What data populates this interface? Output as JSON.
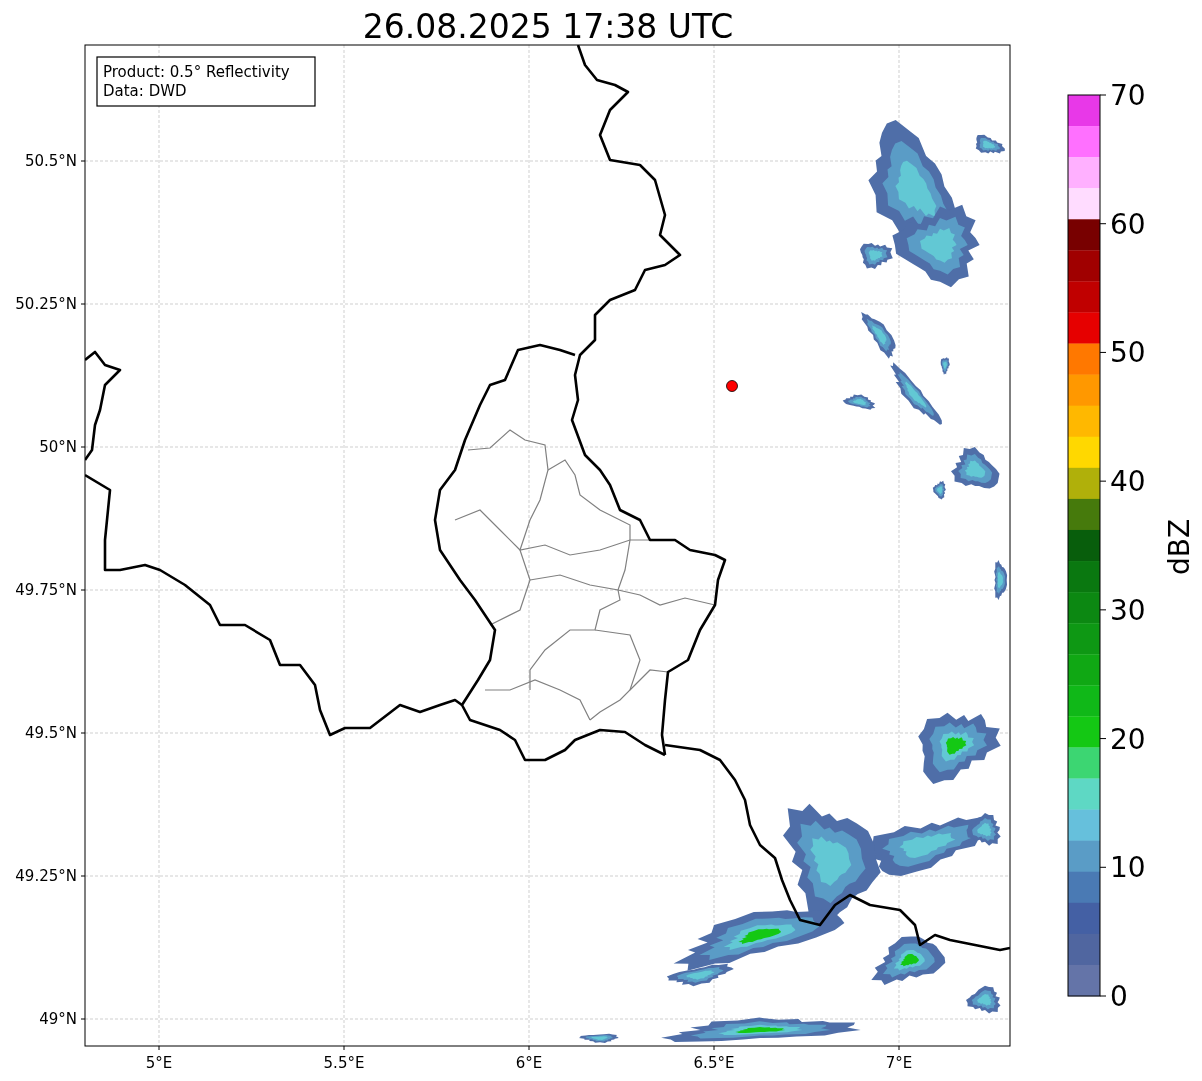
{
  "title": "26.08.2025 17:38 UTC",
  "map": {
    "legend": [
      "Product: 0.5° Reflectivity",
      "Data: DWD"
    ],
    "lat_labels": [
      "50.5°N",
      "50.25°N",
      "50°N",
      "49.75°N",
      "49.5°N",
      "49.25°N",
      "49°N"
    ],
    "lon_labels": [
      "5°E",
      "5.5°E",
      "6°E",
      "6.5°E",
      "7°E"
    ]
  },
  "colorbar": {
    "label": "dBZ",
    "ticks": [
      "70",
      "60",
      "50",
      "40",
      "30",
      "20",
      "10",
      "0"
    ],
    "colors": [
      {
        "color": "#e838e8"
      },
      {
        "color": "#ff70ff"
      },
      {
        "color": "#ffb0ff"
      },
      {
        "color": "#ffdcff"
      },
      {
        "color": "#780000"
      },
      {
        "color": "#a00000"
      },
      {
        "color": "#c00000"
      },
      {
        "color": "#e60000"
      },
      {
        "color": "#ff7800"
      },
      {
        "color": "#ff9800"
      },
      {
        "color": "#ffb800"
      },
      {
        "color": "#ffd800"
      },
      {
        "color": "#b0b00a"
      },
      {
        "color": "#467a0c"
      },
      {
        "color": "#085e0c"
      },
      {
        "color": "#0a7810"
      },
      {
        "color": "#0c8812"
      },
      {
        "color": "#0e9814"
      },
      {
        "color": "#10a814"
      },
      {
        "color": "#10b818"
      },
      {
        "color": "#14c814"
      },
      {
        "color": "#3cd672"
      },
      {
        "color": "#5ed8c4"
      },
      {
        "color": "#66c0dc"
      },
      {
        "color": "#5a9cc6"
      },
      {
        "color": "#4a7ab4"
      },
      {
        "color": "#4460a4"
      },
      {
        "color": "#5066a0"
      },
      {
        "color": "#6474a8"
      }
    ]
  }
}
